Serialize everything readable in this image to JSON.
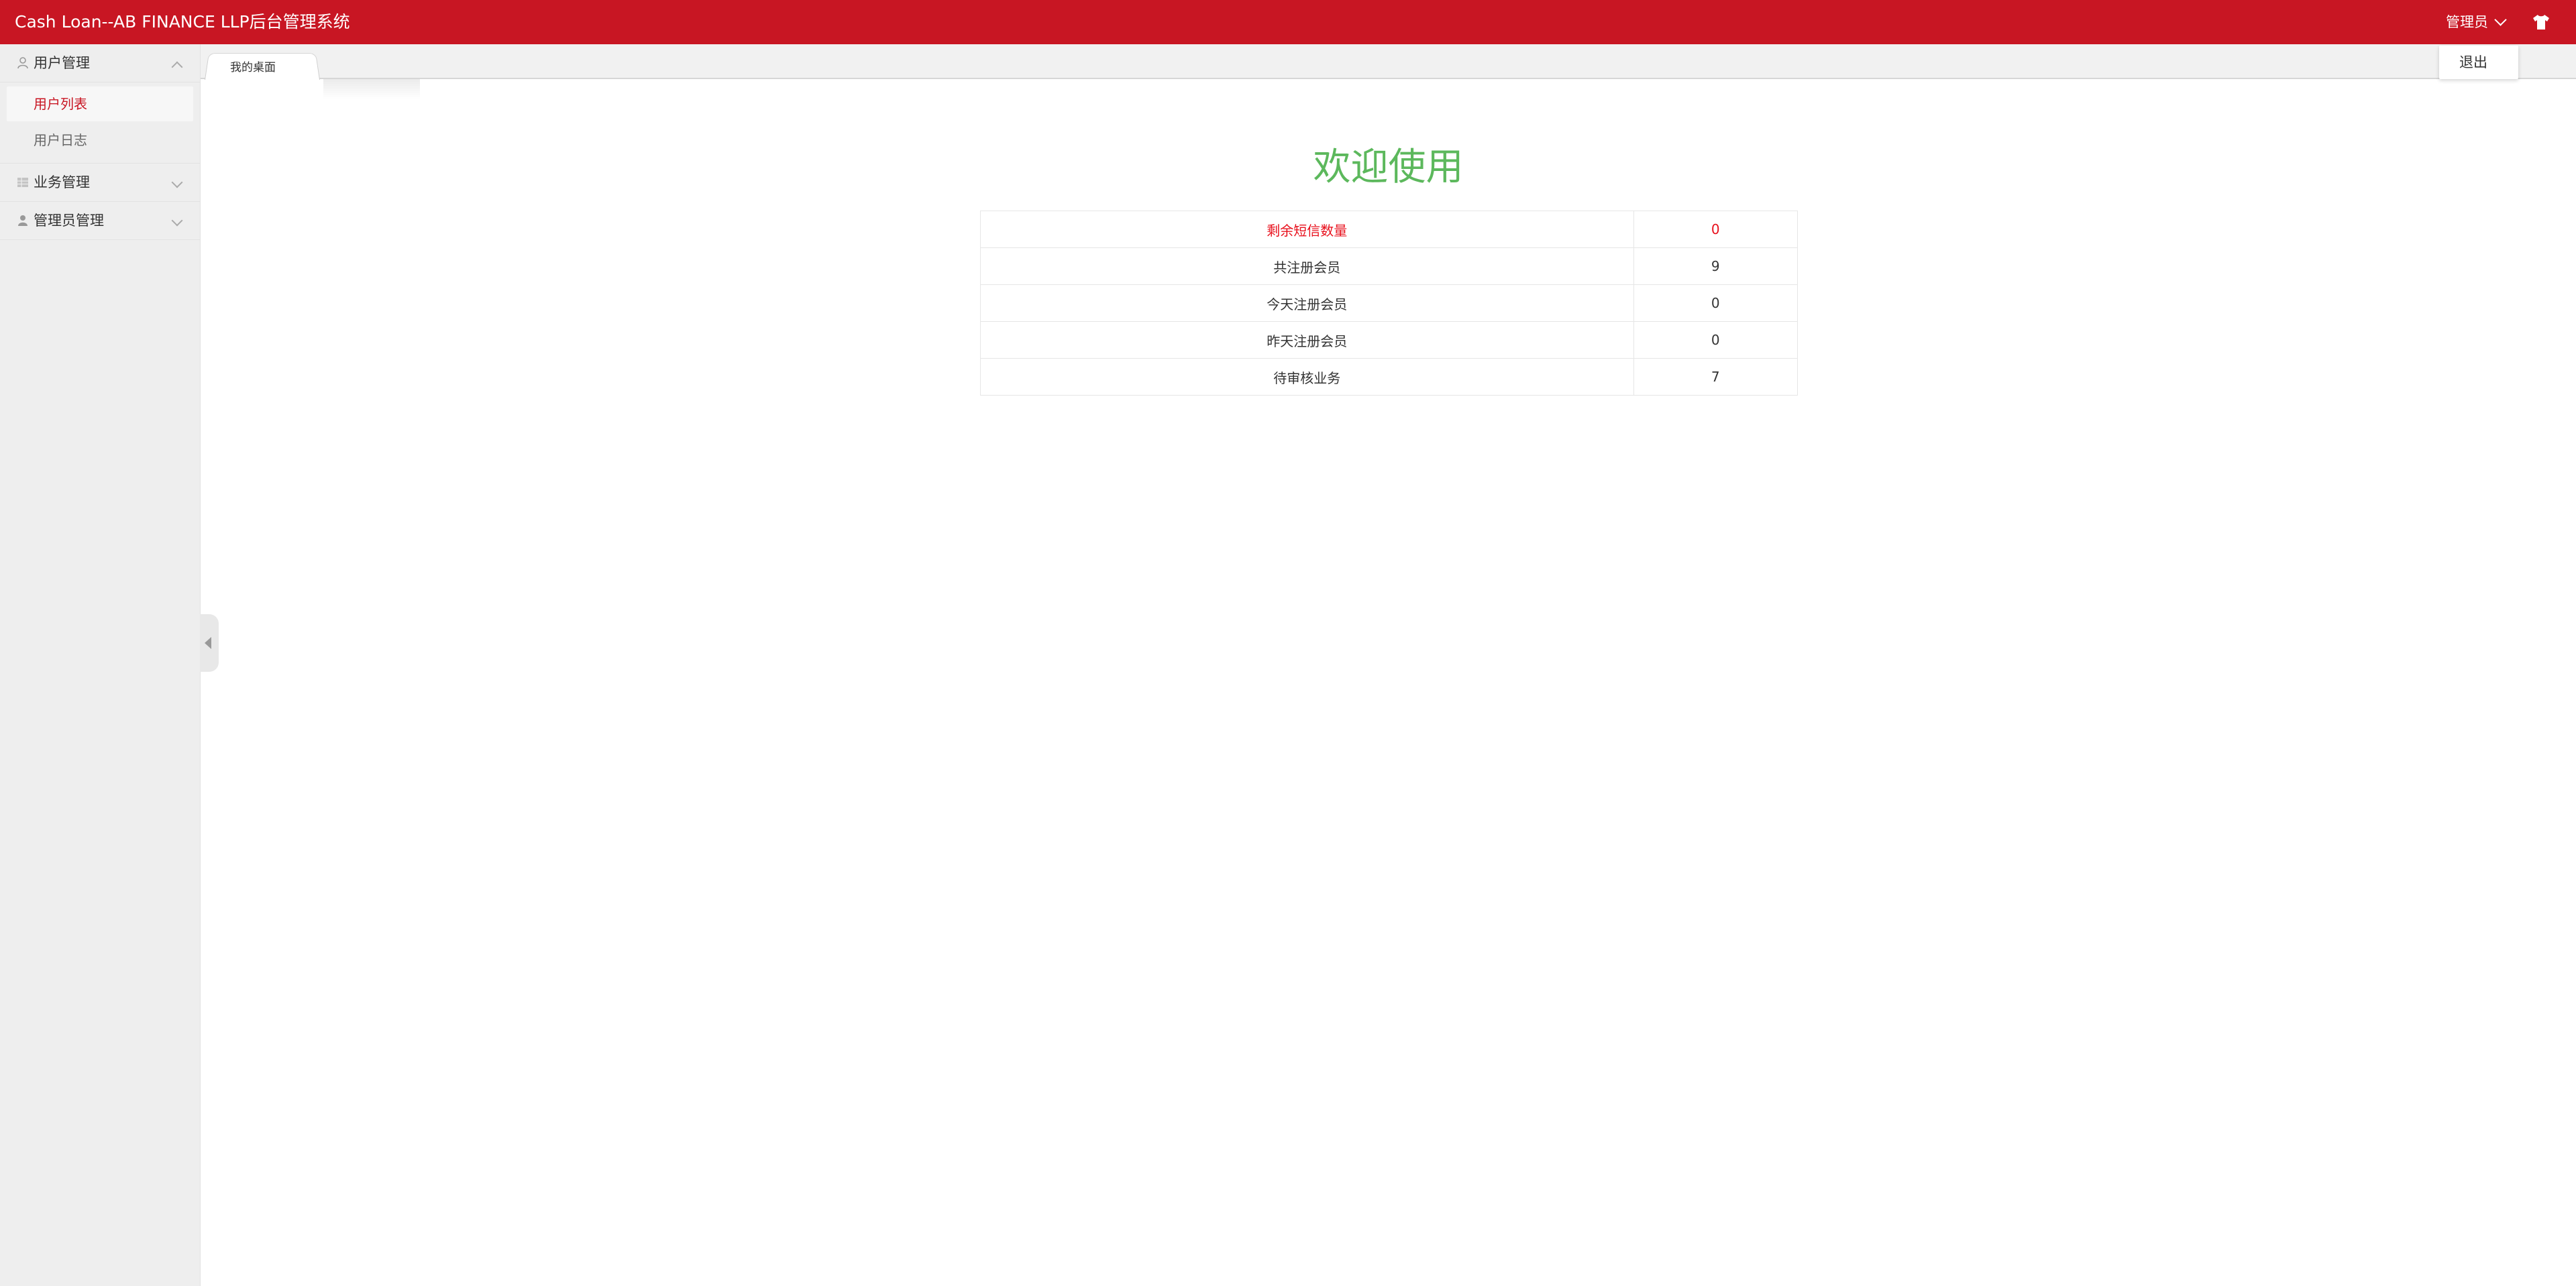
{
  "header": {
    "title": "Cash Loan--AB FINANCE LLP后台管理系统",
    "user_label": "管理员",
    "accent_color": "#c81623",
    "theme_icon": "tshirt-icon"
  },
  "dropdown": {
    "logout_label": "退出"
  },
  "sidebar": {
    "groups": [
      {
        "label": "用户管理",
        "icon": "user-outline-icon",
        "expanded": true,
        "items": [
          {
            "label": "用户列表",
            "active": true
          },
          {
            "label": "用户日志",
            "active": false
          }
        ]
      },
      {
        "label": "业务管理",
        "icon": "grid-icon",
        "expanded": false
      },
      {
        "label": "管理员管理",
        "icon": "user-solid-icon",
        "expanded": false
      }
    ]
  },
  "tabs": [
    {
      "label": "我的桌面",
      "active": true
    }
  ],
  "main": {
    "welcome_text": "欢迎使用",
    "welcome_color": "#5cb85c",
    "stats": [
      {
        "label": "剩余短信数量",
        "value": "0",
        "highlight": true
      },
      {
        "label": "共注册会员",
        "value": "9",
        "highlight": false
      },
      {
        "label": "今天注册会员",
        "value": "0",
        "highlight": false
      },
      {
        "label": "昨天注册会员",
        "value": "0",
        "highlight": false
      },
      {
        "label": "待审核业务",
        "value": "7",
        "highlight": false
      }
    ],
    "highlight_color": "#e8101c"
  }
}
